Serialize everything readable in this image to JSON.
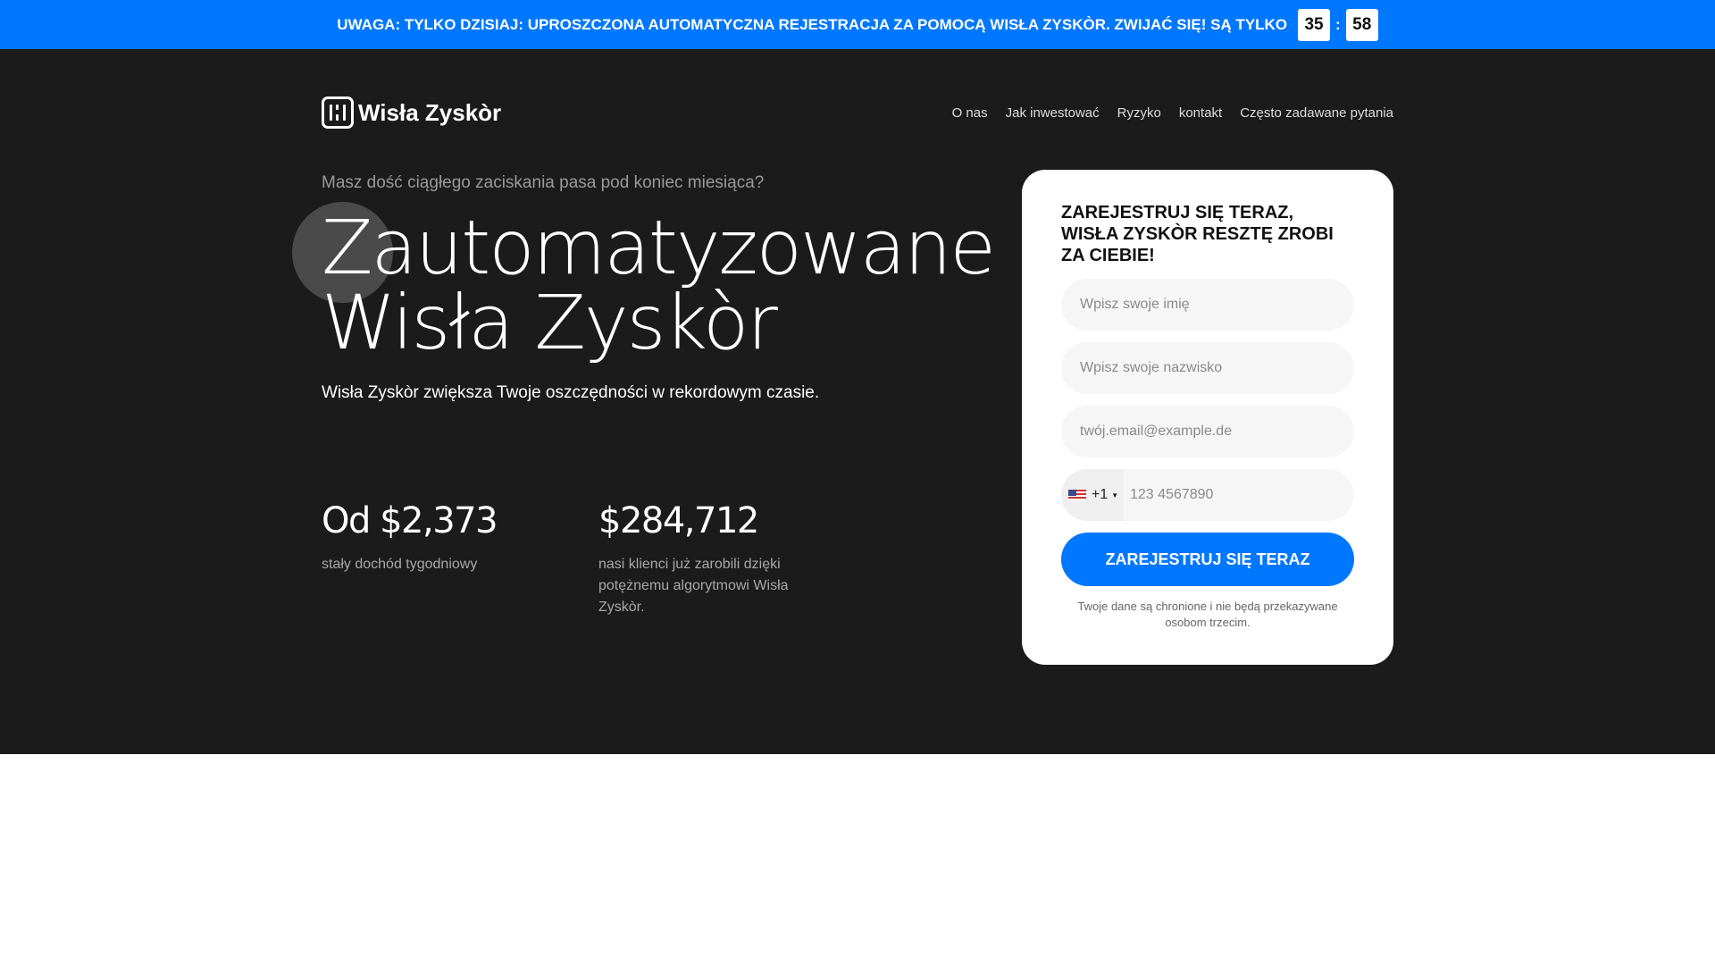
{
  "topbar": {
    "message": "UWAGA: TYLKO DZISIAJ: UPROSZCZONA AUTOMATYCZNA REJESTRACJA ZA POMOCĄ WISŁA ZYSKÒR. ZWIJAĆ SIĘ! SĄ TYLKO",
    "minutes": "35",
    "separator": ":",
    "seconds": "58",
    "color": "#0077ff"
  },
  "header": {
    "logo_text": "Wisła Zyskòr",
    "nav": [
      "O nas",
      "Jak inwestować",
      "Ryzyko",
      "kontakt",
      "Często zadawane pytania"
    ]
  },
  "hero": {
    "subtitle": "Masz dość ciągłego zaciskania pasa pod koniec miesiąca?",
    "headline_line1": "Zautomatyzowane",
    "headline_line2": "Wisła Zyskòr",
    "lead": "Wisła Zyskòr zwiększa Twoje oszczędności w rekordowym czasie.",
    "stats": [
      {
        "value": "Od $2,373",
        "label": "stały dochód tygodniowy"
      },
      {
        "value": "$284,712",
        "label": "nasi klienci już zarobili dzięki potężnemu algorytmowi Wisła Zyskòr."
      }
    ]
  },
  "form": {
    "title": "ZAREJESTRUJ SIĘ TERAZ, WISŁA ZYSKÒR RESZTĘ ZROBI ZA CIEBIE!",
    "first_name_placeholder": "Wpisz swoje imię",
    "last_name_placeholder": "Wpisz swoje nazwisko",
    "email_placeholder": "twój.email@example.de",
    "country_code": "+1",
    "phone_placeholder": "123 4567890",
    "submit_label": "ZAREJESTRUJ SIĘ TERAZ",
    "privacy_note": "Twoje dane są chronione i nie będą przekazywane osobom trzecim."
  }
}
